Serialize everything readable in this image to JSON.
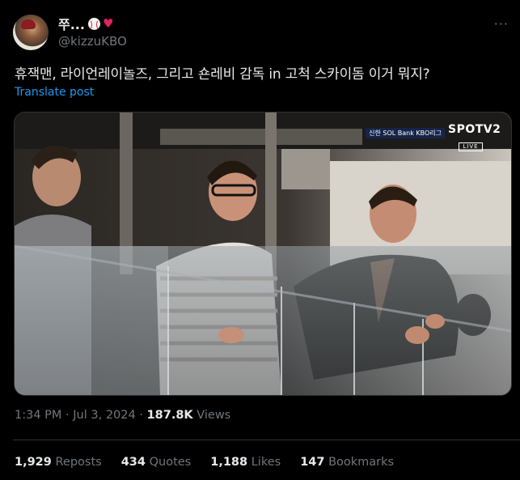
{
  "author": {
    "display_name": "쭈...",
    "handle": "@kizzuKBO",
    "emoji_icons": [
      "baseball-icon",
      "red-heart-icon"
    ]
  },
  "tweet": {
    "text": "휴잭맨, 라이언레이놀즈, 그리고 숀레비 감독 in 고척 스카이돔 이거 뭐지?",
    "translate_label": "Translate post"
  },
  "media": {
    "sponsor_text": "신한 SOL Bank KBO리그",
    "logo_text": "SPOTV2",
    "live_text": "LIVE"
  },
  "meta": {
    "time": "1:34 PM",
    "separator": "·",
    "date": "Jul 3, 2024",
    "views_count": "187.8K",
    "views_label": "Views"
  },
  "stats": {
    "reposts_count": "1,929",
    "reposts_label": "Reposts",
    "quotes_count": "434",
    "quotes_label": "Quotes",
    "likes_count": "1,188",
    "likes_label": "Likes",
    "bookmarks_count": "147",
    "bookmarks_label": "Bookmarks"
  },
  "colors": {
    "background": "#000000",
    "text_primary": "#e7e9ea",
    "text_secondary": "#71767b",
    "link": "#1d9bf0",
    "divider": "#2f3336",
    "heart": "#e0245e"
  },
  "more_icon": "more-horizontal-icon"
}
